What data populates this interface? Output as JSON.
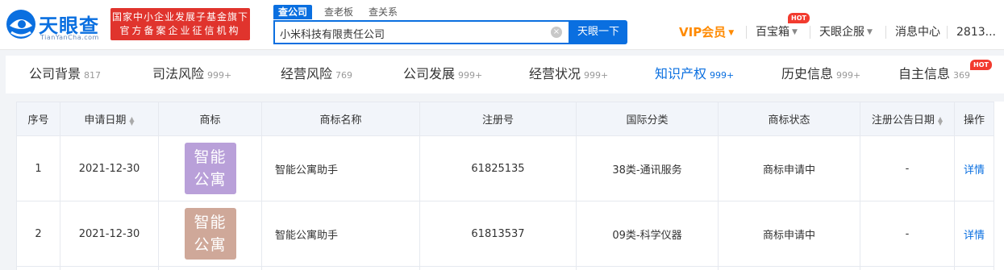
{
  "header": {
    "logo_text": "天眼查",
    "logo_sub": "TianYanCha.com",
    "badge_line1": "国家中小企业发展子基金旗下",
    "badge_line2": "官方备案企业征信机构",
    "search_tabs": [
      "查公司",
      "查老板",
      "查关系"
    ],
    "search_value": "小米科技有限责任公司",
    "search_button": "天眼一下",
    "vip_label": "VIP会员",
    "nav_items": [
      "百宝箱",
      "天眼企服",
      "消息中心",
      "2813..."
    ],
    "hot_label": "HOT"
  },
  "tabs": [
    {
      "label": "公司背景",
      "count": "817"
    },
    {
      "label": "司法风险",
      "count": "999+"
    },
    {
      "label": "经营风险",
      "count": "769"
    },
    {
      "label": "公司发展",
      "count": "999+"
    },
    {
      "label": "经营状况",
      "count": "999+"
    },
    {
      "label": "知识产权",
      "count": "999+"
    },
    {
      "label": "历史信息",
      "count": "999+"
    },
    {
      "label": "自主信息",
      "count": "369"
    }
  ],
  "table": {
    "headers": [
      "序号",
      "申请日期",
      "商标",
      "商标名称",
      "注册号",
      "国际分类",
      "商标状态",
      "注册公告日期",
      "操作"
    ],
    "rows": [
      {
        "index": "1",
        "date": "2021-12-30",
        "mark_line1": "智能",
        "mark_line2": "公寓",
        "mark_color": "#b9a0d9",
        "name": "智能公寓助手",
        "reg_no": "61825135",
        "class": "38类-通讯服务",
        "status": "商标申请中",
        "pub_date": "-",
        "action": "详情"
      },
      {
        "index": "2",
        "date": "2021-12-30",
        "mark_line1": "智能",
        "mark_line2": "公寓",
        "mark_color": "#cfa899",
        "name": "智能公寓助手",
        "reg_no": "61813537",
        "class": "09类-科学仪器",
        "status": "商标申请中",
        "pub_date": "-",
        "action": "详情"
      }
    ]
  },
  "colors": {
    "brand": "#0a6fe0",
    "vip": "#ff8a00",
    "hot": "#f23b2f",
    "badge": "#e0342d"
  }
}
